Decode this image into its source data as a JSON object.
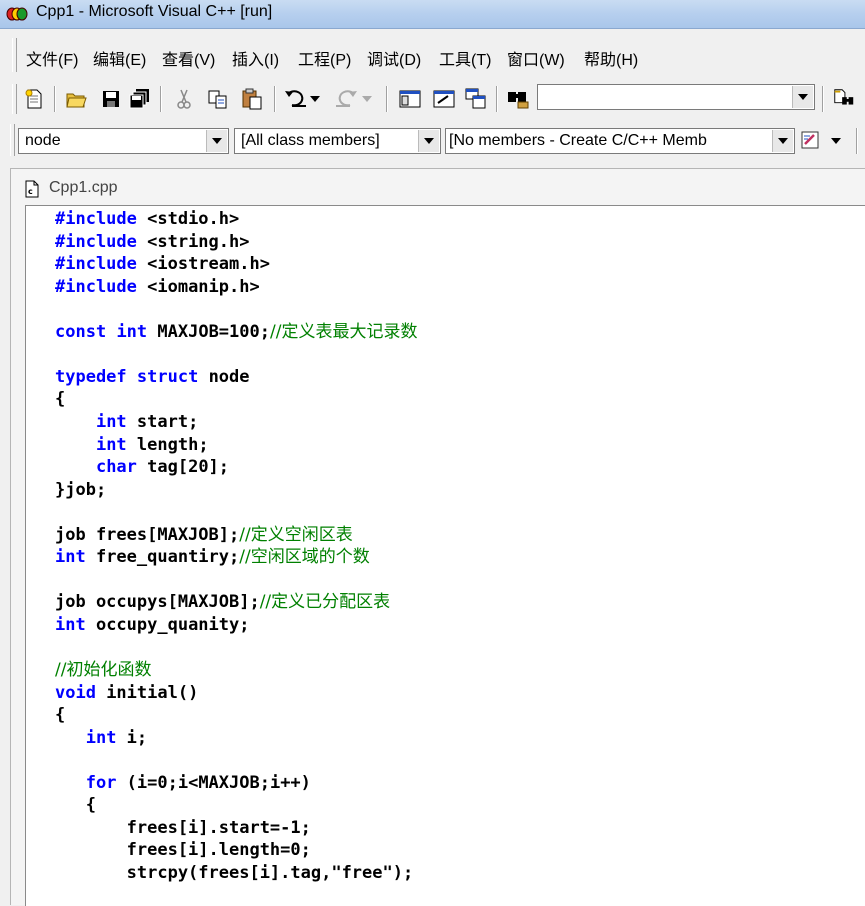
{
  "window": {
    "title": "Cpp1 - Microsoft Visual C++ [run]"
  },
  "menu": [
    {
      "name": "menu-file",
      "label": "文件(F)"
    },
    {
      "name": "menu-edit",
      "label": "编辑(E)"
    },
    {
      "name": "menu-view",
      "label": "查看(V)"
    },
    {
      "name": "menu-insert",
      "label": "插入(I)"
    },
    {
      "name": "menu-project",
      "label": "工程(P)"
    },
    {
      "name": "menu-debug",
      "label": "调试(D)"
    },
    {
      "name": "menu-tools",
      "label": "工具(T)"
    },
    {
      "name": "menu-window",
      "label": "窗口(W)"
    },
    {
      "name": "menu-help",
      "label": "帮助(H)"
    }
  ],
  "toolbar": {
    "find_combo_value": "",
    "icons": [
      "new-file-icon",
      "open-folder-icon",
      "save-icon",
      "save-all-icon",
      "cut-icon",
      "copy-icon",
      "paste-icon",
      "undo-icon",
      "redo-icon",
      "workspace-icon",
      "output-icon",
      "window-list-icon",
      "find-in-files-icon",
      "find-icon"
    ]
  },
  "wizardbar": {
    "class_combo": "node",
    "filter_combo": "[All class members]",
    "members_combo": "[No members - Create C/C++ Memb"
  },
  "document": {
    "tab_title": "Cpp1.cpp",
    "colors": {
      "keyword": "#0000ff",
      "comment": "#008000",
      "text": "#000000"
    }
  },
  "code_lines": [
    [
      {
        "t": "kw",
        "v": "#include"
      },
      {
        "t": "tx",
        "v": " <stdio.h>"
      }
    ],
    [
      {
        "t": "kw",
        "v": "#include"
      },
      {
        "t": "tx",
        "v": " <string.h>"
      }
    ],
    [
      {
        "t": "kw",
        "v": "#include"
      },
      {
        "t": "tx",
        "v": " <iostream.h>"
      }
    ],
    [
      {
        "t": "kw",
        "v": "#include"
      },
      {
        "t": "tx",
        "v": " <iomanip.h>"
      }
    ],
    [],
    [
      {
        "t": "kw",
        "v": "const"
      },
      {
        "t": "tx",
        "v": " "
      },
      {
        "t": "kw",
        "v": "int"
      },
      {
        "t": "tx",
        "v": " MAXJOB=100;"
      },
      {
        "t": "cm",
        "v": "//定义表最大记录数"
      }
    ],
    [],
    [
      {
        "t": "kw",
        "v": "typedef"
      },
      {
        "t": "tx",
        "v": " "
      },
      {
        "t": "kw",
        "v": "struct"
      },
      {
        "t": "tx",
        "v": " node"
      }
    ],
    [
      {
        "t": "tx",
        "v": "{"
      }
    ],
    [
      {
        "t": "tx",
        "v": "    "
      },
      {
        "t": "kw",
        "v": "int"
      },
      {
        "t": "tx",
        "v": " start;"
      }
    ],
    [
      {
        "t": "tx",
        "v": "    "
      },
      {
        "t": "kw",
        "v": "int"
      },
      {
        "t": "tx",
        "v": " length;"
      }
    ],
    [
      {
        "t": "tx",
        "v": "    "
      },
      {
        "t": "kw",
        "v": "char"
      },
      {
        "t": "tx",
        "v": " tag[20];"
      }
    ],
    [
      {
        "t": "tx",
        "v": "}job;"
      }
    ],
    [],
    [
      {
        "t": "tx",
        "v": "job frees[MAXJOB];"
      },
      {
        "t": "cm",
        "v": "//定义空闲区表"
      }
    ],
    [
      {
        "t": "kw",
        "v": "int"
      },
      {
        "t": "tx",
        "v": " free_quantiry;"
      },
      {
        "t": "cm",
        "v": "//空闲区域的个数"
      }
    ],
    [],
    [
      {
        "t": "tx",
        "v": "job occupys[MAXJOB];"
      },
      {
        "t": "cm",
        "v": "//定义已分配区表"
      }
    ],
    [
      {
        "t": "kw",
        "v": "int"
      },
      {
        "t": "tx",
        "v": " occupy_quanity;"
      }
    ],
    [],
    [
      {
        "t": "cm",
        "v": "//初始化函数"
      }
    ],
    [
      {
        "t": "kw",
        "v": "void"
      },
      {
        "t": "tx",
        "v": " initial()"
      }
    ],
    [
      {
        "t": "tx",
        "v": "{"
      }
    ],
    [
      {
        "t": "tx",
        "v": "   "
      },
      {
        "t": "kw",
        "v": "int"
      },
      {
        "t": "tx",
        "v": " i;"
      }
    ],
    [],
    [
      {
        "t": "tx",
        "v": "   "
      },
      {
        "t": "kw",
        "v": "for"
      },
      {
        "t": "tx",
        "v": " (i=0;i<MAXJOB;i++)"
      }
    ],
    [
      {
        "t": "tx",
        "v": "   {"
      }
    ],
    [
      {
        "t": "tx",
        "v": "       frees[i].start=-1;"
      }
    ],
    [
      {
        "t": "tx",
        "v": "       frees[i].length=0;"
      }
    ],
    [
      {
        "t": "tx",
        "v": "       strcpy(frees[i].tag,\"free\");"
      }
    ]
  ]
}
